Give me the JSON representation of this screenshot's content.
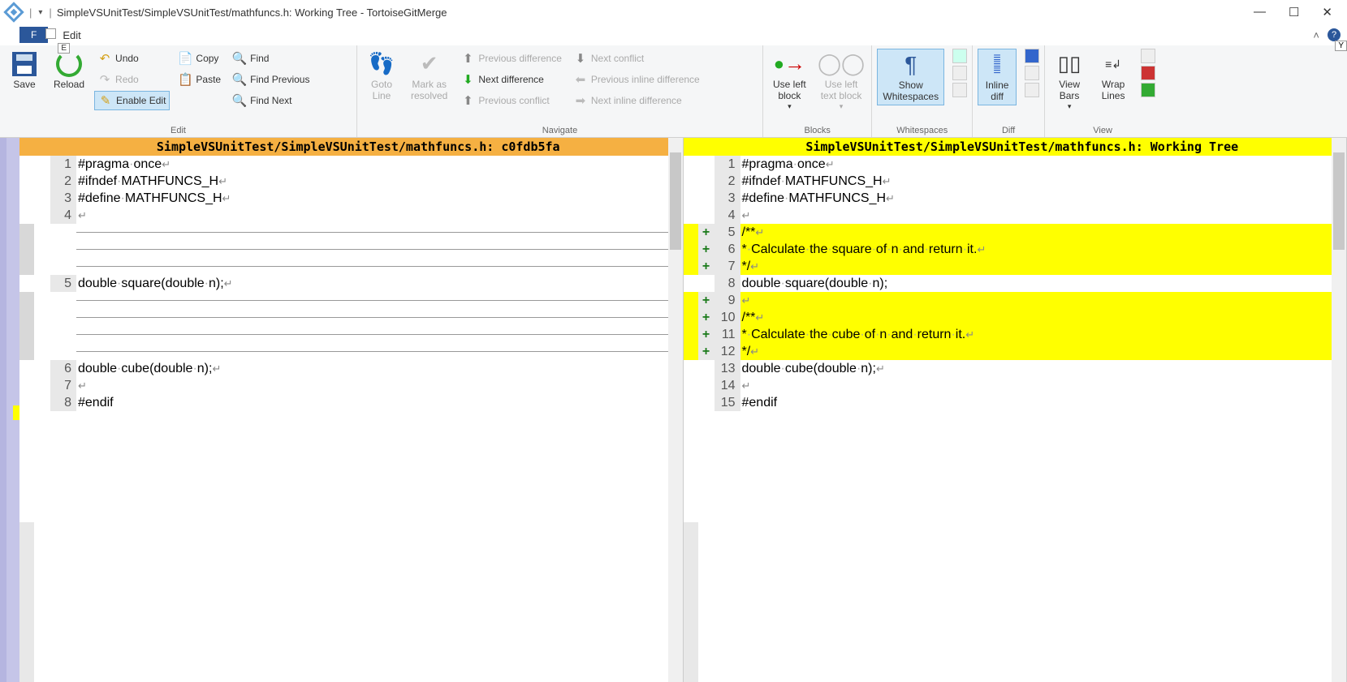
{
  "titlebar": {
    "title": "SimpleVSUnitTest/SimpleVSUnitTest/mathfuncs.h: Working Tree - TortoiseGitMerge"
  },
  "qat": {
    "file_label": "F",
    "edit_label": "Edit",
    "edit_key": "E",
    "y_key": "Y"
  },
  "ribbon": {
    "save": "Save",
    "reload": "Reload",
    "undo": "Undo",
    "redo": "Redo",
    "enable_edit": "Enable Edit",
    "copy": "Copy",
    "paste": "Paste",
    "find": "Find",
    "find_prev": "Find Previous",
    "find_next": "Find Next",
    "goto_line": "Goto\nLine",
    "mark_resolved": "Mark as\nresolved",
    "prev_diff": "Previous difference",
    "next_diff": "Next difference",
    "prev_conflict": "Previous conflict",
    "next_conflict": "Next conflict",
    "prev_inline": "Previous inline difference",
    "next_inline": "Next inline difference",
    "use_left_block": "Use left\nblock",
    "use_left_text": "Use left\ntext block",
    "show_ws": "Show\nWhitespaces",
    "inline_diff": "Inline\ndiff",
    "view_bars": "View\nBars",
    "wrap_lines": "Wrap\nLines",
    "groups": {
      "edit": "Edit",
      "navigate": "Navigate",
      "blocks": "Blocks",
      "whitespaces": "Whitespaces",
      "diff": "Diff",
      "view": "View"
    }
  },
  "left_pane": {
    "header": "SimpleVSUnitTest/SimpleVSUnitTest/mathfuncs.h: c0fdb5fa",
    "lines": [
      {
        "n": "1",
        "t": "#pragma·once",
        "type": "n"
      },
      {
        "n": "2",
        "t": "#ifndef·MATHFUNCS_H",
        "type": "n"
      },
      {
        "n": "3",
        "t": "#define·MATHFUNCS_H",
        "type": "n"
      },
      {
        "n": "4",
        "t": "",
        "type": "n"
      },
      {
        "n": "",
        "t": "",
        "type": "gap"
      },
      {
        "n": "",
        "t": "",
        "type": "gap"
      },
      {
        "n": "",
        "t": "",
        "type": "gap"
      },
      {
        "n": "5",
        "t": "double·square(double·n);",
        "type": "n"
      },
      {
        "n": "",
        "t": "",
        "type": "gap"
      },
      {
        "n": "",
        "t": "",
        "type": "gap"
      },
      {
        "n": "",
        "t": "",
        "type": "gap"
      },
      {
        "n": "",
        "t": "",
        "type": "gap"
      },
      {
        "n": "6",
        "t": "double·cube(double·n);",
        "type": "n"
      },
      {
        "n": "7",
        "t": "",
        "type": "n"
      },
      {
        "n": "8",
        "t": "#endif",
        "type": "n"
      }
    ]
  },
  "right_pane": {
    "header": "SimpleVSUnitTest/SimpleVSUnitTest/mathfuncs.h: Working Tree",
    "lines": [
      {
        "n": "1",
        "t": "#pragma·once",
        "type": "n"
      },
      {
        "n": "2",
        "t": "#ifndef·MATHFUNCS_H",
        "type": "n"
      },
      {
        "n": "3",
        "t": "#define·MATHFUNCS_H",
        "type": "n"
      },
      {
        "n": "4",
        "t": "",
        "type": "n"
      },
      {
        "n": "5",
        "t": "/**",
        "type": "a"
      },
      {
        "n": "6",
        "t": "*·Calculate·the·square·of·n·and·return·it.",
        "type": "a"
      },
      {
        "n": "7",
        "t": "*/",
        "type": "a"
      },
      {
        "n": "8",
        "t": "double·square(double·n);",
        "type": "n"
      },
      {
        "n": "9",
        "t": "",
        "type": "a"
      },
      {
        "n": "10",
        "t": "/**",
        "type": "a"
      },
      {
        "n": "11",
        "t": "*·Calculate·the·cube·of·n·and·return·it.",
        "type": "a"
      },
      {
        "n": "12",
        "t": "*/",
        "type": "a"
      },
      {
        "n": "13",
        "t": "double·cube(double·n);",
        "type": "n"
      },
      {
        "n": "14",
        "t": "",
        "type": "n"
      },
      {
        "n": "15",
        "t": "#endif",
        "type": "n"
      }
    ]
  }
}
